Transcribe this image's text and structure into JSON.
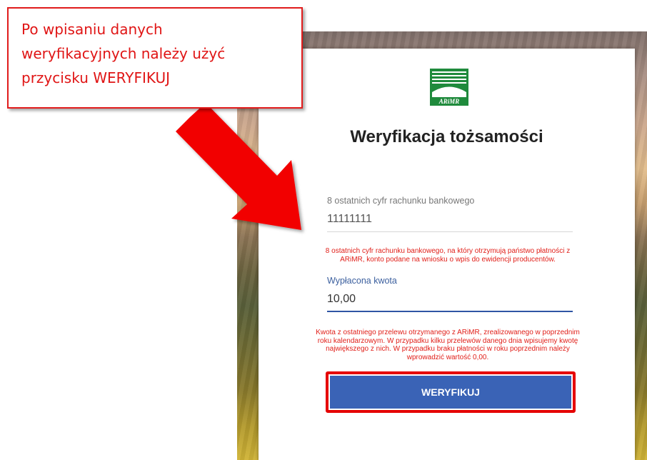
{
  "callout": {
    "lines": [
      "Po wpisaniu danych",
      "weryfikacyjnych należy użyć",
      "przycisku WERYFIKUJ"
    ]
  },
  "logo": {
    "text": "ARiMR"
  },
  "page": {
    "title": "Weryfikacja tożsamości"
  },
  "account_field": {
    "label": "8 ostatnich cyfr rachunku bankowego",
    "value": "11111111",
    "hint_lines": [
      "8 ostatnich cyfr rachunku bankowego, na który otrzymują państwo płatności z",
      "ARiMR, konto podane na wniosku o wpis do ewidencji producentów."
    ]
  },
  "amount_field": {
    "label": "Wypłacona kwota",
    "value": "10,00",
    "hint_lines": [
      "Kwota z ostatniego przelewu otrzymanego z ARiMR, zrealizowanego w poprzednim",
      "roku kalendarzowym. W przypadku kilku przelewów danego dnia wpisujemy kwotę",
      "największego z nich. W przypadku braku płatności w roku poprzednim należy",
      "wprowadzić wartość 0,00."
    ]
  },
  "verify_button": {
    "label": "WERYFIKUJ"
  },
  "colors": {
    "accent": "#2f55a4",
    "button": "#3a63b6",
    "hint_red": "#e1201a",
    "highlight_red": "#e50000",
    "logo_green": "#1f8a3c"
  }
}
